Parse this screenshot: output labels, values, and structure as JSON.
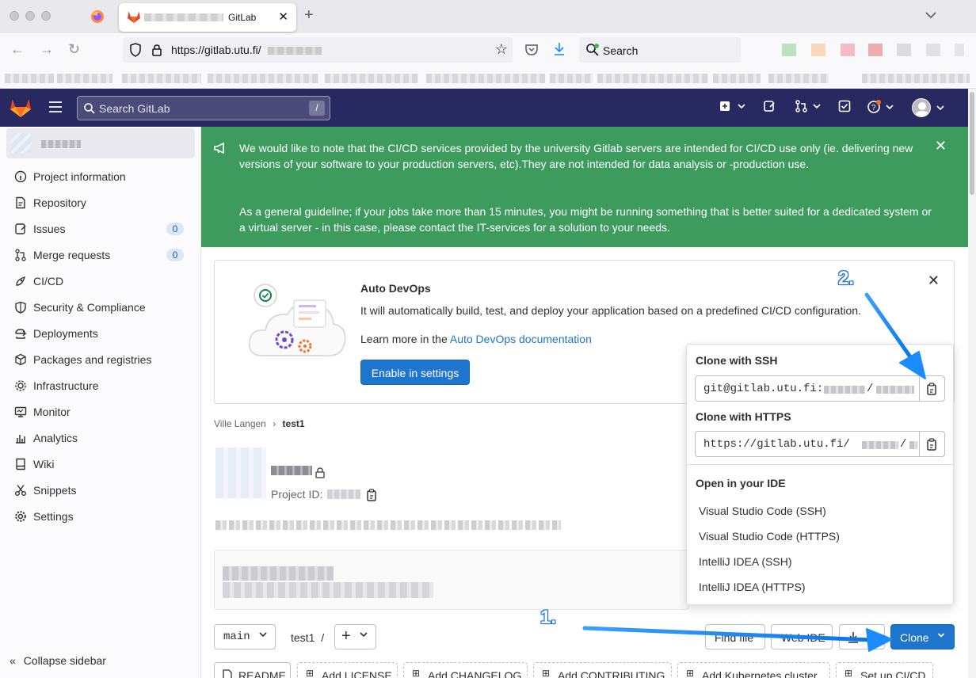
{
  "browser": {
    "tab_title": "GitLab",
    "url": "https://gitlab.utu.fi/",
    "search_placeholder": "Search"
  },
  "gitlab_header": {
    "search_placeholder": "Search GitLab",
    "search_shortcut": "/"
  },
  "sidebar": {
    "items": [
      {
        "label": "Project information",
        "icon": "info-icon"
      },
      {
        "label": "Repository",
        "icon": "doc-icon"
      },
      {
        "label": "Issues",
        "icon": "issues-icon",
        "badge": "0"
      },
      {
        "label": "Merge requests",
        "icon": "merge-icon",
        "badge": "0"
      },
      {
        "label": "CI/CD",
        "icon": "rocket-icon"
      },
      {
        "label": "Security & Compliance",
        "icon": "shield-icon"
      },
      {
        "label": "Deployments",
        "icon": "deploy-icon"
      },
      {
        "label": "Packages and registries",
        "icon": "package-icon"
      },
      {
        "label": "Infrastructure",
        "icon": "cloud-gear-icon"
      },
      {
        "label": "Monitor",
        "icon": "monitor-icon"
      },
      {
        "label": "Analytics",
        "icon": "chart-icon"
      },
      {
        "label": "Wiki",
        "icon": "book-icon"
      },
      {
        "label": "Snippets",
        "icon": "scissors-icon"
      },
      {
        "label": "Settings",
        "icon": "gear-icon"
      }
    ],
    "collapse_label": "Collapse sidebar"
  },
  "banner": {
    "line1": "We would like to note that the CI/CD services provided by the university Gitlab servers are intended for CI/CD use only (ie. delivering new versions of your software to your production servers, etc).They are not intended for data analysis or -production use.",
    "line2": "As a general guideline; if your jobs take more than 15 minutes, you might be running something that is better suited for a dedicated system or a virtual server - in this case, please contact the IT-services for a solution to your needs.",
    "color": "#3d9b5d"
  },
  "devops": {
    "title": "Auto DevOps",
    "description": "It will automatically build, test, and deploy your application based on a predefined CI/CD configuration.",
    "learn_prefix": "Learn more in the ",
    "learn_link": "Auto DevOps documentation",
    "button": "Enable in settings"
  },
  "breadcrumb": {
    "parent": "Ville Langen",
    "current": "test1"
  },
  "project": {
    "id_label": "Project ID:"
  },
  "repo_toolbar": {
    "branch": "main",
    "path": "test1",
    "path_sep": "/",
    "find_file": "Find file",
    "web_ide": "Web IDE",
    "clone": "Clone"
  },
  "quick_actions": [
    {
      "label": "README"
    },
    {
      "label": "Add LICENSE"
    },
    {
      "label": "Add CHANGELOG"
    },
    {
      "label": "Add CONTRIBUTING"
    },
    {
      "label": "Add Kubernetes cluster"
    },
    {
      "label": "Set up CI/CD"
    }
  ],
  "clone_dropdown": {
    "ssh_title": "Clone with SSH",
    "ssh_url": "git@gitlab.utu.fi:",
    "https_title": "Clone with HTTPS",
    "https_url": "https://gitlab.utu.fi/",
    "ide_title": "Open in your IDE",
    "ide_options": [
      "Visual Studio Code (SSH)",
      "Visual Studio Code (HTTPS)",
      "IntelliJ IDEA (SSH)",
      "IntelliJ IDEA (HTTPS)"
    ]
  },
  "annotations": {
    "step1": "1.",
    "step2": "2.",
    "color": "#1a8cff"
  }
}
